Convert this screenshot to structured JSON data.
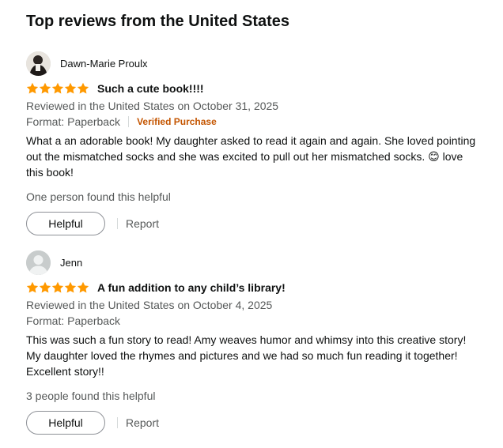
{
  "section": {
    "title": "Top reviews from the United States"
  },
  "colors": {
    "star": "#ff9900",
    "verified": "#c45500",
    "muted": "#565959"
  },
  "reviews": [
    {
      "profile_name": "Dawn-Marie Proulx",
      "avatar_icon": "profile-photo",
      "rating": 5,
      "title": "Such a cute book!!!!",
      "date_line": "Reviewed in the United States on October 31, 2025",
      "format": "Format: Paperback",
      "verified": "Verified Purchase",
      "body": "What a an adorable book! My daughter asked to read it again and again. She loved pointing out the mismatched socks and she was excited to pull out her mismatched socks. 😊 love this book!",
      "helpful_count": "One person found this helpful",
      "helpful_label": "Helpful",
      "report_label": "Report"
    },
    {
      "profile_name": "Jenn",
      "avatar_icon": "default-user-icon",
      "rating": 5,
      "title": "A fun addition to any child’s library!",
      "date_line": "Reviewed in the United States on October 4, 2025",
      "format": "Format: Paperback",
      "body": "This was such a fun story to read! Amy weaves humor and whimsy into this creative story! My daughter loved the rhymes and pictures and we had so much fun reading it together! Excellent story!!",
      "helpful_count": "3 people found this helpful",
      "helpful_label": "Helpful",
      "report_label": "Report"
    }
  ]
}
